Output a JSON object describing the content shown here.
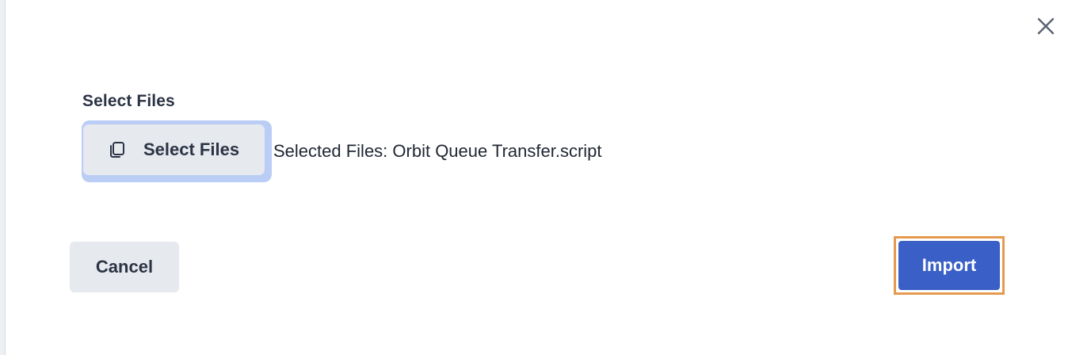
{
  "dialog": {
    "close_icon": "close-icon",
    "section_label": "Select Files",
    "select_button": {
      "icon": "copy-files-icon",
      "label": "Select Files"
    },
    "selected_files_text": "Selected Files: Orbit Queue Transfer.script",
    "cancel_label": "Cancel",
    "import_label": "Import"
  },
  "colors": {
    "primary": "#3a5fc6",
    "secondary_bg": "#e6e9ee",
    "focus_ring": "#b9cdf5",
    "highlight_outline": "#e49a4f",
    "text_dark": "#2b3445"
  }
}
